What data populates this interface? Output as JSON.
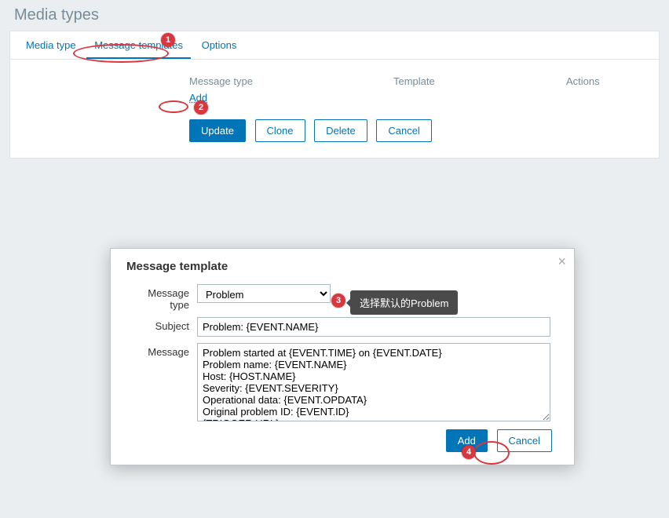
{
  "page": {
    "title": "Media types"
  },
  "tabs": {
    "media_type": "Media type",
    "message_templates": "Message templates",
    "options": "Options"
  },
  "table": {
    "cols": {
      "message_type": "Message type",
      "template": "Template",
      "actions": "Actions"
    },
    "add_link": "Add"
  },
  "buttons": {
    "update": "Update",
    "clone": "Clone",
    "delete": "Delete",
    "cancel": "Cancel"
  },
  "modal": {
    "title": "Message template",
    "labels": {
      "message_type": "Message type",
      "subject": "Subject",
      "message": "Message"
    },
    "message_type_value": "Problem",
    "subject_value": "Problem: {EVENT.NAME}",
    "message_value": "Problem started at {EVENT.TIME} on {EVENT.DATE}\nProblem name: {EVENT.NAME}\nHost: {HOST.NAME}\nSeverity: {EVENT.SEVERITY}\nOperational data: {EVENT.OPDATA}\nOriginal problem ID: {EVENT.ID}\n{TRIGGER.URL}",
    "add": "Add",
    "cancel": "Cancel"
  },
  "annotations": {
    "m1": "1",
    "m2": "2",
    "m3": "3",
    "m4": "4",
    "tip3": "选择默认的Problem"
  }
}
